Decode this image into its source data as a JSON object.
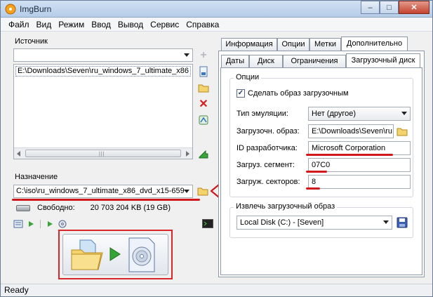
{
  "window": {
    "title": "ImgBurn",
    "minimize": "–",
    "maximize": "□",
    "close": "✕"
  },
  "menu": [
    "Файл",
    "Вид",
    "Режим",
    "Ввод",
    "Вывод",
    "Сервис",
    "Справка"
  ],
  "left": {
    "source_label": "Источник",
    "source_combo_value": "",
    "source_file": "E:\\Downloads\\Seven\\ru_windows_7_ultimate_x86",
    "dest_label": "Назначение",
    "dest_value": "C:\\iso\\ru_windows_7_ultimate_x86_dvd_x15-659",
    "free_label": "Свободно:",
    "free_value": "20 703 204 KB  (19 GB)"
  },
  "tabs": {
    "row1": [
      "Информация",
      "Опции",
      "Метки",
      "Дополнительно"
    ],
    "row2": [
      "Даты",
      "Диск",
      "Ограничения",
      "Загрузочный диск"
    ],
    "active_row1": "Дополнительно",
    "active_row2": "Загрузочный диск"
  },
  "options": {
    "legend": "Опции",
    "make_bootable": "Сделать образ загрузочным",
    "make_bootable_checked": true,
    "emulation_label": "Тип эмуляции:",
    "emulation_value": "Нет (другое)",
    "boot_image_label": "Загрузочн. образ:",
    "boot_image_value": "E:\\Downloads\\Seven\\ru",
    "developer_id_label": "ID разработчика:",
    "developer_id_value": "Microsoft Corporation",
    "load_segment_label": "Загруз. сегмент:",
    "load_segment_value": "07C0",
    "sectors_label": "Загруж. секторов:",
    "sectors_value": "8"
  },
  "extract": {
    "legend": "Извлечь загрузочный образ",
    "drive_value": "Local Disk (C:) - [Seven]"
  },
  "status": {
    "text": "Ready"
  },
  "colors": {
    "highlight_red": "#d0191d"
  }
}
